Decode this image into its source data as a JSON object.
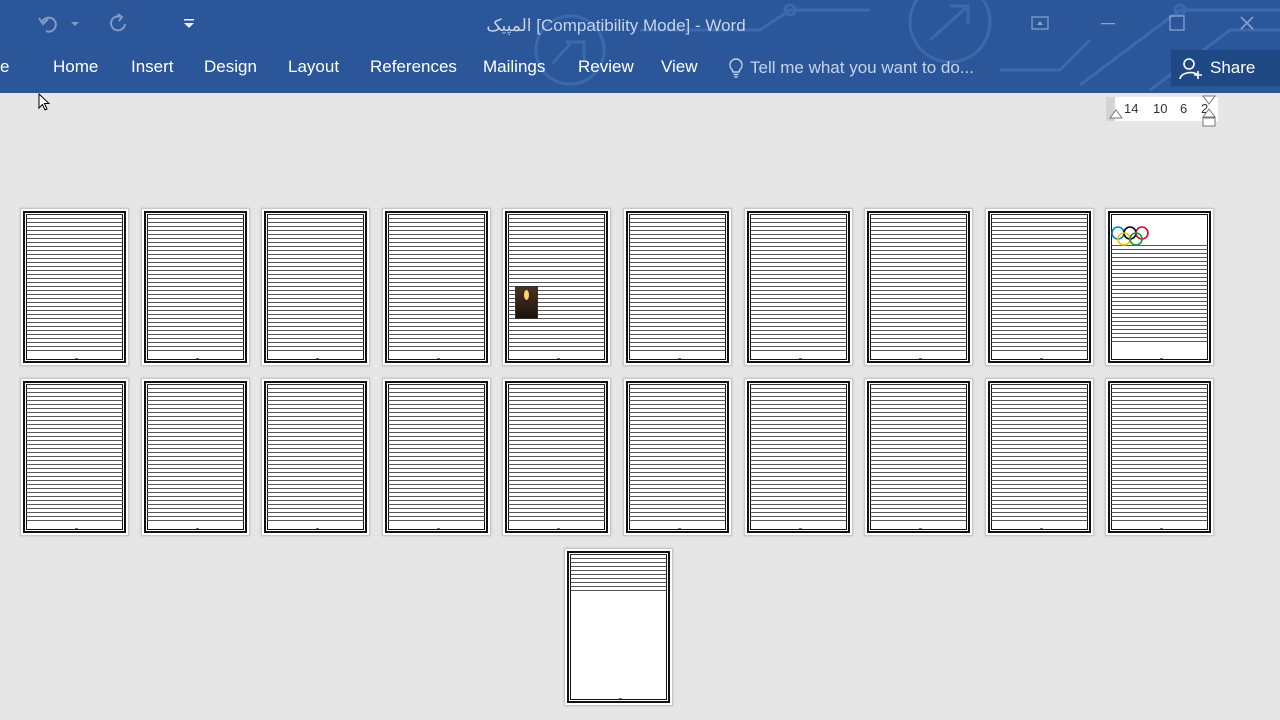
{
  "window": {
    "doc_name": "المپیک",
    "title_suffix": " [Compatibility Mode] - Word"
  },
  "quick_access": {
    "undo": "undo-icon",
    "redo": "redo-icon",
    "customize": "customize-icon"
  },
  "ribbon": {
    "file_fragment": "e",
    "tabs": [
      {
        "label": "Home"
      },
      {
        "label": "Insert"
      },
      {
        "label": "Design"
      },
      {
        "label": "Layout"
      },
      {
        "label": "References"
      },
      {
        "label": "Mailings"
      },
      {
        "label": "Review"
      },
      {
        "label": "View"
      }
    ],
    "tell_me": "Tell me what you want to do...",
    "share": "Share"
  },
  "ruler": {
    "ticks": [
      "14",
      "10",
      "6",
      "2"
    ]
  },
  "document": {
    "page_count": 21
  },
  "colors": {
    "ribbon": "#2b579a",
    "share_bg": "#1f4985",
    "canvas": "#e6e6e6"
  }
}
